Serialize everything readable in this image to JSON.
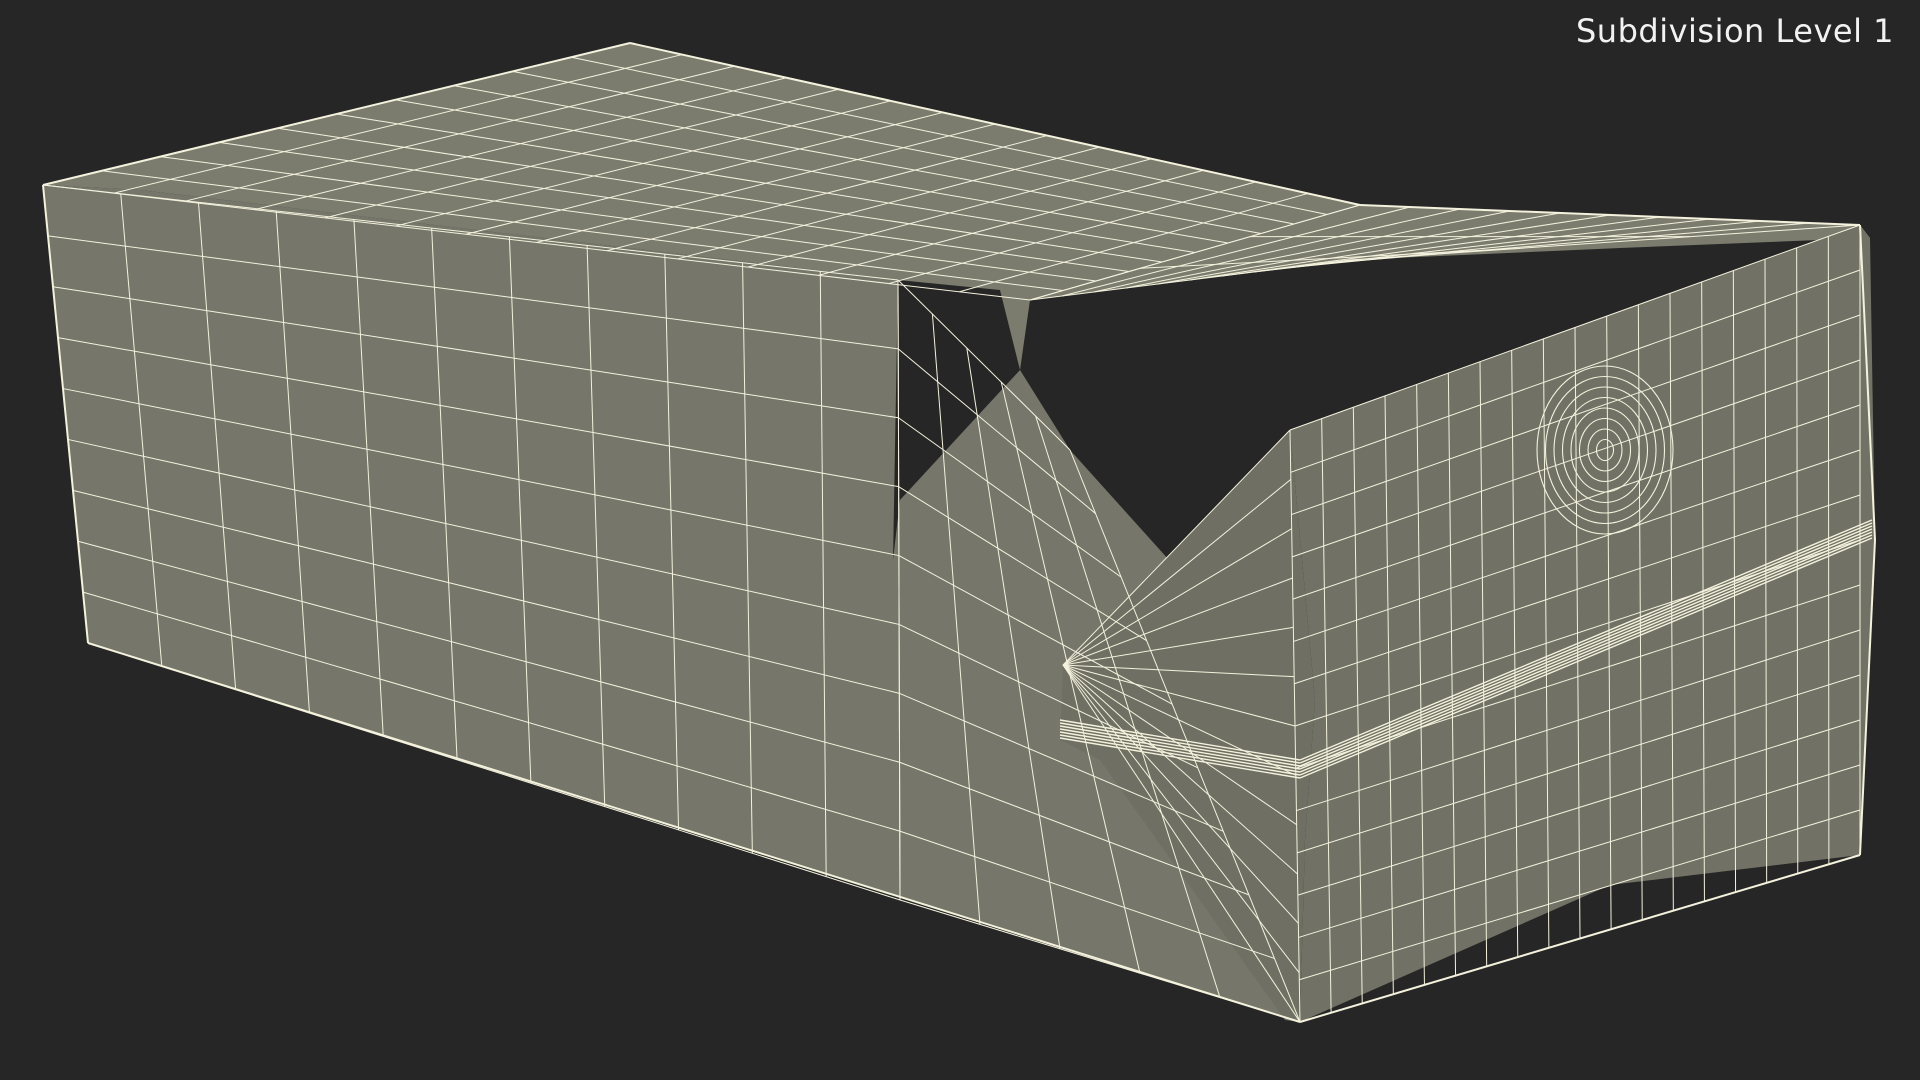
{
  "viewport": {
    "subdivision_label": "Subdivision Level 1",
    "background_color": "#262626",
    "mesh_fill_color": "#7a7b6d",
    "wire_color": "#f4f1dd"
  },
  "model": {
    "name": "box-wireframe-model",
    "display_mode": "wireframe-on-shaded"
  }
}
